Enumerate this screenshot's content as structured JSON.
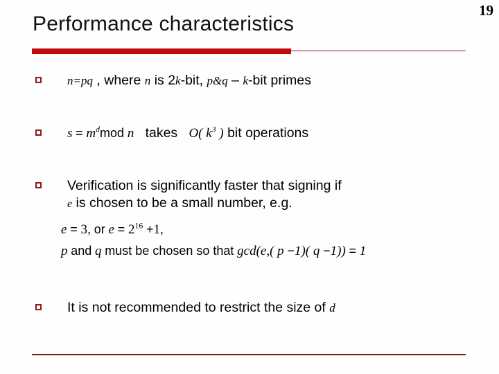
{
  "slide": {
    "title": "Performance characteristics",
    "page_number": "19",
    "accent_color": "#c20a0a",
    "rule_color": "#8b1a1a",
    "background_color": "#fefefe",
    "text_color": "#000000"
  },
  "bullets": [
    {
      "id": "bullet-1",
      "marker": "hollow-square",
      "segments": [
        {
          "style": "math",
          "text": "n=pq"
        },
        {
          "style": "plain",
          "text": " , where "
        },
        {
          "style": "math",
          "text": "n"
        },
        {
          "style": "plain",
          "text": " is 2"
        },
        {
          "style": "math",
          "text": "k"
        },
        {
          "style": "plain",
          "text": "-bit,  "
        },
        {
          "style": "math",
          "text": "p&q"
        },
        {
          "style": "plain",
          "text": " – "
        },
        {
          "style": "math",
          "text": "k"
        },
        {
          "style": "plain",
          "text": "-bit primes"
        }
      ],
      "plain_text": "n=pq , where n is 2k-bit, p&q – k-bit primes"
    },
    {
      "id": "bullet-2",
      "marker": "hollow-square",
      "equation_left": "s = m^d mod n",
      "middle_text": "takes",
      "equation_right": "O( k^3 )",
      "trailing_text": "bit operations",
      "plain_text": "s = m^d mod n takes O(k^3) bit operations"
    },
    {
      "id": "bullet-3",
      "marker": "hollow-square",
      "line1": "Verification is significantly faster that signing if",
      "variable": "e",
      "line2": "is chosen to be a small number, e.g.",
      "plain_text": "Verification is significantly faster that signing if e is chosen to be a small number, e.g."
    },
    {
      "id": "bullet-4",
      "marker": "hollow-square",
      "text": "It is not recommended to restrict the size of",
      "variable": "d",
      "plain_text": "It is not recommended to restrict the size of d"
    }
  ],
  "equation_block": {
    "line1": {
      "part1": "e = 3,",
      "connector": "or",
      "part2": "e = 2^16 + 1,",
      "plain_text": "e = 3, or e = 2^16 + 1,"
    },
    "line2": {
      "var_p": "p",
      "connector1": "and",
      "var_q": "q",
      "connector2": "must be chosen so that",
      "formula": "gcd(e,( p −1)( q −1)) = 1",
      "plain_text": "p and q must be chosen so that gcd(e,( p −1)( q −1)) = 1"
    }
  }
}
